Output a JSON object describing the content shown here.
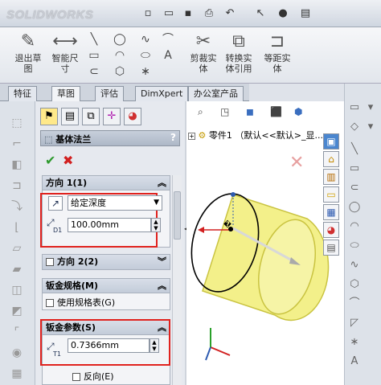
{
  "app": {
    "logo": "SOLIDWORKS"
  },
  "quick_access": {
    "icons": [
      "new-icon",
      "open-icon",
      "save-icon",
      "print-icon",
      "undo-icon",
      "select-icon",
      "rebuild-icon",
      "options-icon"
    ]
  },
  "ribbon": {
    "exit_sketch": "退出草\n图",
    "smart_dimension": "智能尺\n寸",
    "trim": "剪裁实\n体",
    "convert": "转换实\n体引用",
    "offset": "等距实\n体"
  },
  "tabs": [
    {
      "label": "特征"
    },
    {
      "label": "草图"
    },
    {
      "label": "评估"
    },
    {
      "label": "DimXpert"
    },
    {
      "label": "办公室产品"
    }
  ],
  "tree": {
    "root": "零件1 （默认<<默认>_显..."
  },
  "feature": {
    "title": "基体法兰",
    "help": "?"
  },
  "direction1": {
    "header": "方向 1(1)",
    "end_condition": "给定深度",
    "depth": "100.00mm",
    "depth_label": "D1"
  },
  "direction2": {
    "header": "方向 2(2)"
  },
  "sheet_gauges": {
    "header": "钣金规格(M)",
    "use_gauge": "使用规格表(G)"
  },
  "sheet_params": {
    "header": "钣金参数(S)",
    "thickness": "0.7366mm",
    "thickness_label": "T1",
    "reverse": "反向(E)"
  },
  "colors": {
    "accent_red": "#e0221e",
    "ok_green": "#2e9a2e",
    "cancel_red": "#d22020",
    "cylinder_yellow": "#f3f08a"
  }
}
